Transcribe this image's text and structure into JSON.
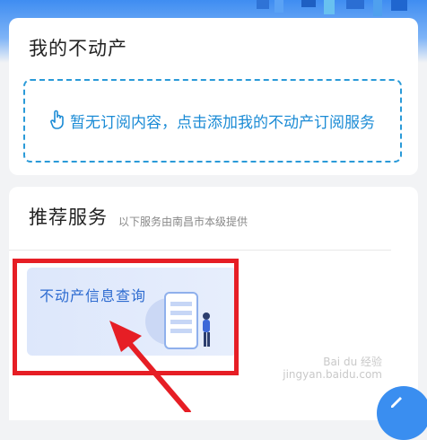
{
  "my_property": {
    "title": "我的不动产",
    "empty_message": "暂无订阅内容，点击添加我的不动产订阅服务"
  },
  "recommended": {
    "title": "推荐服务",
    "subtitle": "以下服务由南昌市本级提供",
    "services": [
      {
        "label": "不动产信息查询"
      }
    ]
  },
  "watermark": {
    "line1": "Bai du 经验",
    "line2": "jingyan.baidu.com"
  },
  "colors": {
    "accent": "#1b8bd5",
    "annotation_red": "#e61e25"
  },
  "icons": {
    "tap": "hand-tap-icon",
    "edit": "pencil-icon"
  }
}
